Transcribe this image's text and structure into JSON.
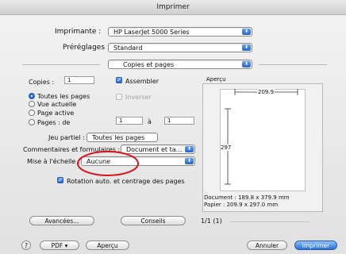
{
  "window": {
    "title": "Imprimer"
  },
  "printer": {
    "label": "Imprimante :",
    "value": "HP LaserJet 5000 Series"
  },
  "presets": {
    "label": "Préréglages :",
    "value": "Standard"
  },
  "panel": {
    "value": "Copies et pages"
  },
  "copies": {
    "label": "Copies :",
    "value": "1",
    "collate_label": "Assembler",
    "reverse_label": "Inverser"
  },
  "pages": {
    "all": "Toutes les pages",
    "current": "Vue actuelle",
    "selection": "Page active",
    "range_label": "Pages : de",
    "from": "1",
    "to_label": "à",
    "to": "1"
  },
  "sets": {
    "label": "Jeu partiel :",
    "value": "Toutes les pages"
  },
  "comments": {
    "label": "Commentaires et formulaires :",
    "value": "Document et ta..."
  },
  "scale": {
    "label": "Mise à l'échelle :",
    "value": "Aucune"
  },
  "rotate": {
    "label": "Rotation auto. et centrage des pages"
  },
  "preview": {
    "title": "Aperçu",
    "width": "209.9",
    "height": "297",
    "document": "Document : 189.8 x 379.9 mm",
    "paper": "Papier : 209.9 x 297.0 mm"
  },
  "advanced": {
    "label": "Avancées..."
  },
  "tips": {
    "label": "Conseils"
  },
  "page_counter": "1/1 (1)",
  "footer": {
    "help": "?",
    "pdf": "PDF ▾",
    "preview": "Aperçu",
    "cancel": "Annuler",
    "print": "Imprimer"
  },
  "colors": {
    "accent": "#2a6fd8",
    "annotation": "#d8141b"
  }
}
